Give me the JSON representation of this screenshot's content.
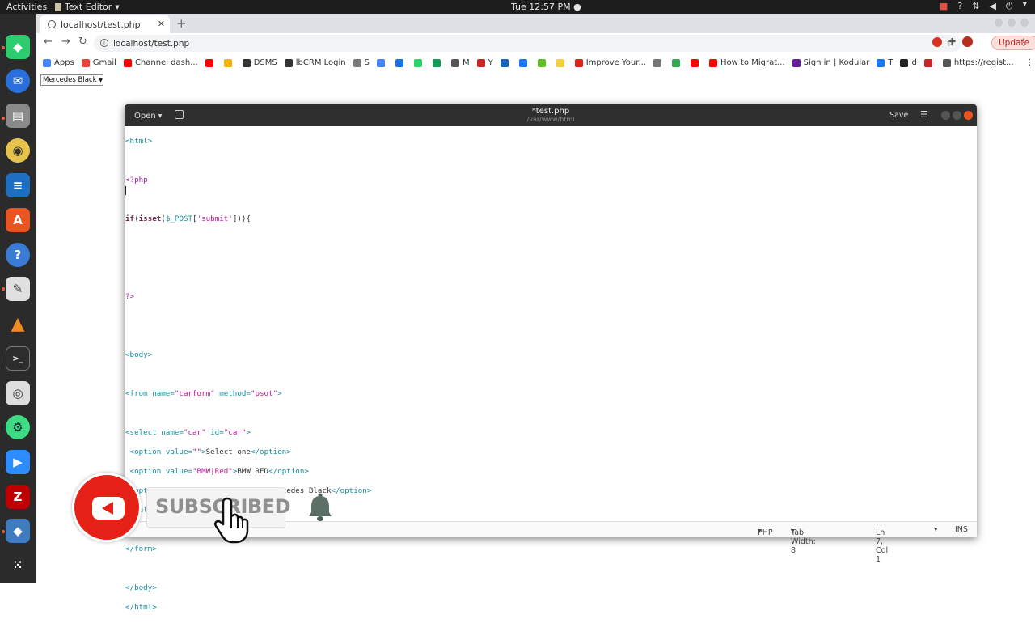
{
  "topbar": {
    "activities": "Activities",
    "app_name": "Text Editor",
    "clock": "Tue 12:57 PM"
  },
  "browser": {
    "tab_title": "localhost/test.php",
    "url": "localhost/test.php",
    "update_label": "Update",
    "bookmarks": [
      {
        "label": "Apps",
        "color": "#4285f4"
      },
      {
        "label": "Gmail",
        "color": "#ea4335"
      },
      {
        "label": "Channel dash...",
        "color": "#ff0000"
      },
      {
        "label": "",
        "color": "#ff0000"
      },
      {
        "label": "",
        "color": "#f4b400"
      },
      {
        "label": "DSMS",
        "color": "#333333"
      },
      {
        "label": "lbCRM Login",
        "color": "#333333"
      },
      {
        "label": "S",
        "color": "#7a7a7a"
      },
      {
        "label": "",
        "color": "#4285f4"
      },
      {
        "label": "",
        "color": "#1a73e8"
      },
      {
        "label": "",
        "color": "#25d366"
      },
      {
        "label": "",
        "color": "#0f9d58"
      },
      {
        "label": "M",
        "color": "#555555"
      },
      {
        "label": "Y",
        "color": "#c62828"
      },
      {
        "label": "",
        "color": "#1565c0"
      },
      {
        "label": "",
        "color": "#1877f2"
      },
      {
        "label": "",
        "color": "#5bbf21"
      },
      {
        "label": "",
        "color": "#f4d03f"
      },
      {
        "label": "Improve Your...",
        "color": "#e62117"
      },
      {
        "label": "",
        "color": "#777777"
      },
      {
        "label": "",
        "color": "#34a853"
      },
      {
        "label": "",
        "color": "#ff0000"
      },
      {
        "label": "How to Migrat...",
        "color": "#ff0000"
      },
      {
        "label": "Sign in | Kodular",
        "color": "#6a1b9a"
      },
      {
        "label": "T",
        "color": "#1877f2"
      },
      {
        "label": "d",
        "color": "#222222"
      },
      {
        "label": "",
        "color": "#c62828"
      },
      {
        "label": "https://regist...",
        "color": "#555555"
      }
    ]
  },
  "page": {
    "select_value": "Mercedes Black"
  },
  "editor": {
    "open_label": "Open",
    "title": "*test.php",
    "subtitle": "/var/www/html",
    "save_label": "Save",
    "status": {
      "language": "PHP",
      "tab_width": "Tab Width: 8",
      "position": "Ln 7, Col 1",
      "mode": "INS"
    }
  },
  "overlay": {
    "subscribe_text": "SUBSCRIBED"
  },
  "colors": {
    "youtube_red": "#e62117",
    "update_red": "#c5221f"
  }
}
